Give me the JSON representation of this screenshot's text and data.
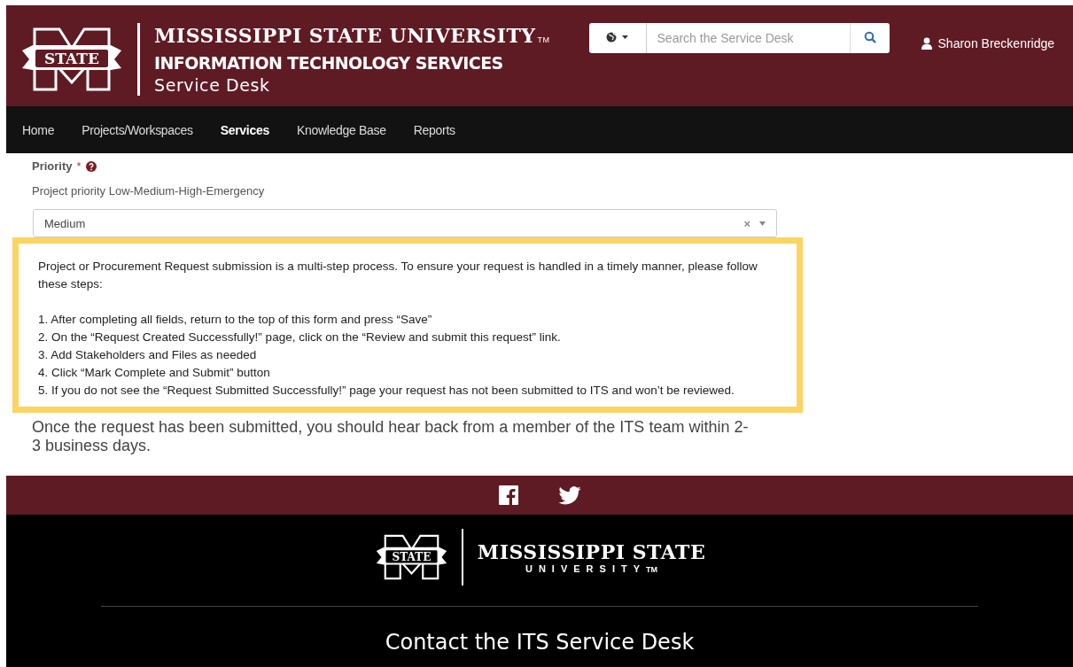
{
  "header": {
    "logo_text": "STATE",
    "title": "MISSISSIPPI STATE UNIVERSITY",
    "trademark": "TM",
    "subtitle": "INFORMATION TECHNOLOGY SERVICES",
    "tagline": "Service Desk"
  },
  "search": {
    "placeholder": "Search the Service Desk"
  },
  "user": {
    "name": "Sharon Breckenridge"
  },
  "nav": [
    {
      "label": "Home",
      "selected": false
    },
    {
      "label": "Projects/Workspaces",
      "selected": false
    },
    {
      "label": "Services",
      "selected": true
    },
    {
      "label": "Knowledge Base",
      "selected": false
    },
    {
      "label": "Reports",
      "selected": false
    }
  ],
  "priority": {
    "label": "Priority",
    "required_mark": "*",
    "help": "Project priority Low-Medium-High-Emergency",
    "value": "Medium",
    "clear": "×"
  },
  "notice": {
    "intro": "Project or Procurement Request submission is a multi-step process. To ensure your request is handled in a timely manner, please follow these steps:",
    "steps": [
      "1. After completing all fields, return to the top of this form and press “Save”",
      "2. On the “Request Created Successfully!” page, click on the “Review and submit this request” link.",
      "3. Add Stakeholders and Files as needed",
      "4. Click “Mark Complete and Submit” button",
      "5. If you do not see the “Request Submitted Successfully!” page your request has not been submitted to ITS and won’t be reviewed."
    ]
  },
  "closing": "Once the request has been submitted, you should hear back from a member of the ITS team within 2-3 business days.",
  "footer": {
    "logo_text": "STATE",
    "title": "MISSISSIPPI STATE",
    "subtitle": "UNIVERSITY",
    "trademark": "TM",
    "contact": "Contact the ITS Service Desk"
  }
}
